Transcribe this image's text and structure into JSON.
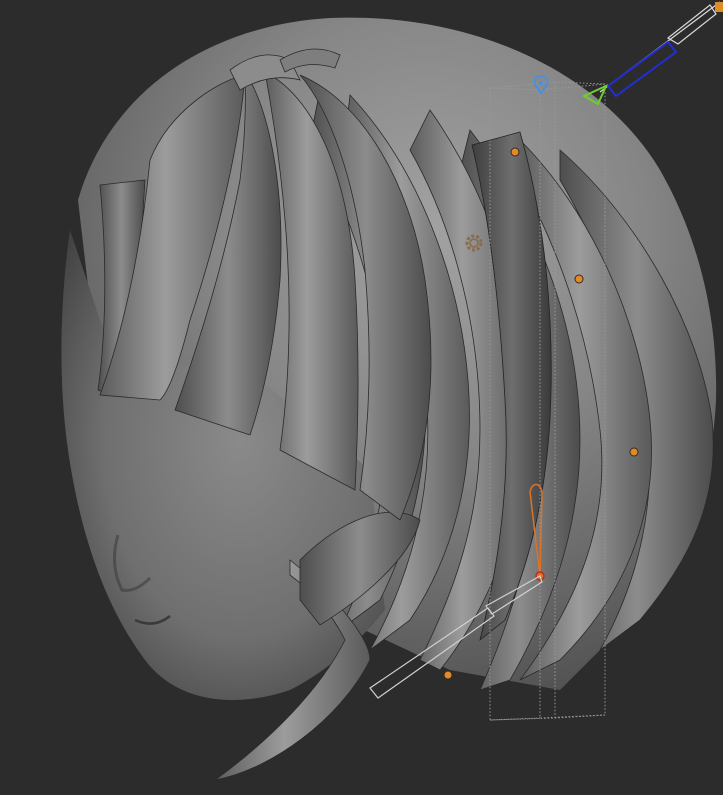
{
  "viewport": {
    "background": "#2c2c2c",
    "model": "sculpted-head-with-bob-hair",
    "render_mode": "matcap-grey"
  },
  "colors": {
    "surface_light": "#9a9a9a",
    "surface_mid": "#7a7a7a",
    "surface_dark": "#4a4a4a",
    "gizmo_blue": "#1f2fd6",
    "gizmo_green": "#6cd12a",
    "handle_orange": "#e08a2a",
    "bezier_orange": "#d9742a",
    "pivot_blue": "#4a8fe0",
    "gear_color": "#8a6a4a"
  },
  "icons": {
    "gear": "gear-icon",
    "pivot": "pivot-marker-icon",
    "handle": "control-point-icon"
  }
}
